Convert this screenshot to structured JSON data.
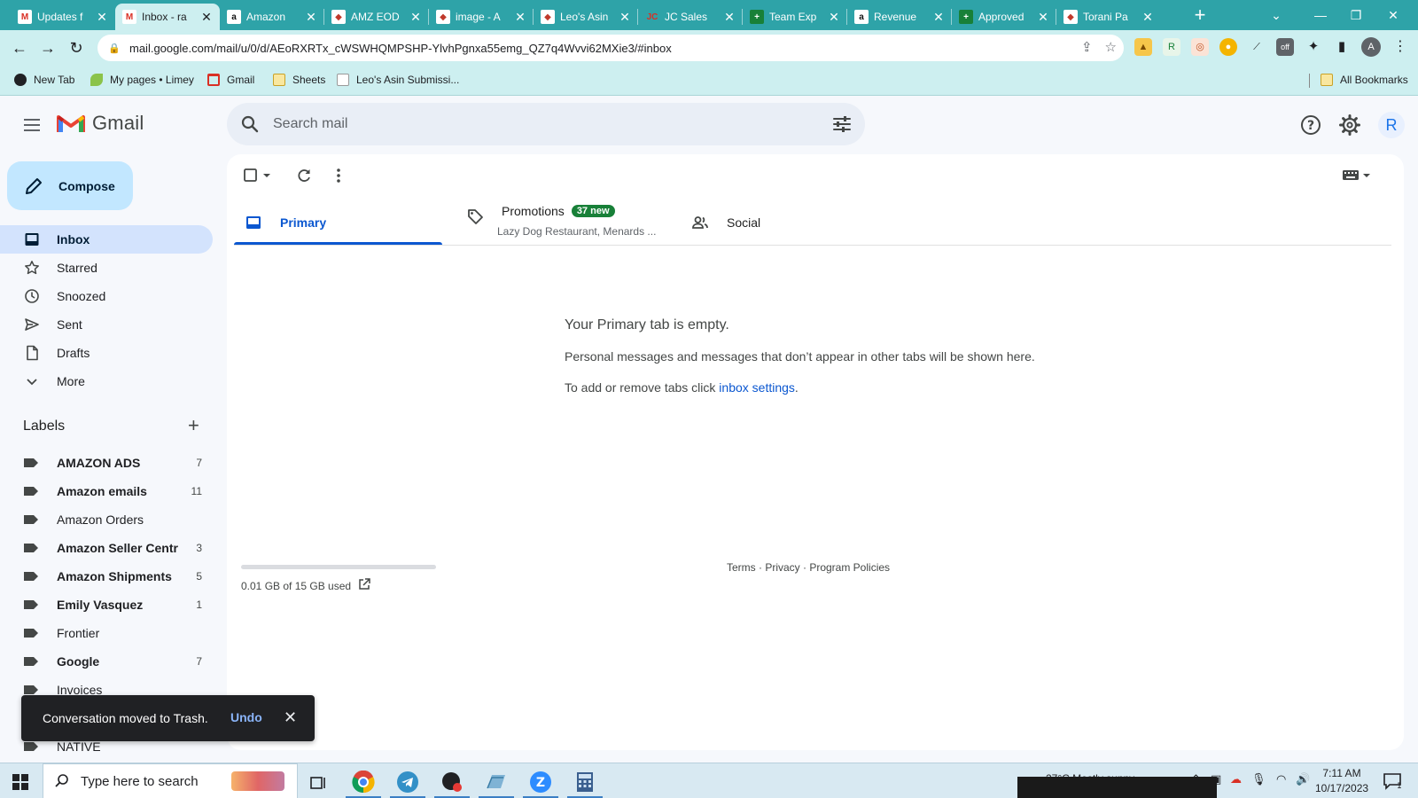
{
  "browser": {
    "tabs": [
      {
        "title": "Updates f",
        "favicon": "gmail-icon"
      },
      {
        "title": "Inbox - ra",
        "favicon": "gmail-icon",
        "active": true
      },
      {
        "title": "Amazon",
        "favicon": "amazon-icon"
      },
      {
        "title": "AMZ EOD",
        "favicon": "app-icon"
      },
      {
        "title": "image - A",
        "favicon": "app-icon"
      },
      {
        "title": "Leo's Asin",
        "favicon": "app-icon"
      },
      {
        "title": "JC Sales",
        "favicon": "jc-icon"
      },
      {
        "title": "Team Exp",
        "favicon": "sheets-icon"
      },
      {
        "title": "Revenue",
        "favicon": "amazon-icon"
      },
      {
        "title": "Approved",
        "favicon": "sheets-icon"
      },
      {
        "title": "Torani Pa",
        "favicon": "app-icon"
      }
    ],
    "url": "mail.google.com/mail/u/0/d/AEoRXRTx_cWSWHQMPSHP-YlvhPgnxa55emg_QZ7q4Wvvi62MXie3/#inbox",
    "profile_initial": "A",
    "bookmarks": [
      "New Tab",
      "My pages • Limey",
      "Gmail",
      "Sheets",
      "Leo's Asin Submissi..."
    ],
    "all_bookmarks": "All Bookmarks"
  },
  "gmail": {
    "logo_text": "Gmail",
    "search_placeholder": "Search mail",
    "avatar_initial": "R",
    "compose_label": "Compose",
    "nav": [
      {
        "label": "Inbox",
        "icon": "inbox-icon",
        "active": true
      },
      {
        "label": "Starred",
        "icon": "star-icon"
      },
      {
        "label": "Snoozed",
        "icon": "clock-icon"
      },
      {
        "label": "Sent",
        "icon": "send-icon"
      },
      {
        "label": "Drafts",
        "icon": "draft-icon"
      },
      {
        "label": "More",
        "icon": "chevron-down-icon"
      }
    ],
    "labels_heading": "Labels",
    "labels": [
      {
        "name": "AMAZON ADS",
        "count": "7",
        "bold": true
      },
      {
        "name": "Amazon emails",
        "count": "11",
        "bold": true
      },
      {
        "name": "Amazon Orders",
        "count": "",
        "bold": false
      },
      {
        "name": "Amazon Seller Centr",
        "count": "3",
        "bold": true
      },
      {
        "name": "Amazon Shipments",
        "count": "5",
        "bold": true
      },
      {
        "name": "Emily Vasquez",
        "count": "1",
        "bold": true
      },
      {
        "name": "Frontier",
        "count": "",
        "bold": false
      },
      {
        "name": "Google",
        "count": "7",
        "bold": true
      },
      {
        "name": "Invoices",
        "count": "",
        "bold": false
      },
      {
        "name": "",
        "count": "",
        "bold": false
      },
      {
        "name": "NATIVE",
        "count": "",
        "bold": false
      }
    ],
    "tabs": {
      "primary": "Primary",
      "promotions": "Promotions",
      "promotions_badge": "37 new",
      "promotions_snippet": "Lazy Dog Restaurant, Menards ...",
      "social": "Social"
    },
    "empty": {
      "title": "Your Primary tab is empty.",
      "line1": "Personal messages and messages that don’t appear in other tabs will be shown here.",
      "line2_prefix": "To add or remove tabs click ",
      "line2_link": "inbox settings",
      "line2_suffix": "."
    },
    "storage": {
      "text": "0.01 GB of 15 GB used",
      "used_fraction": 0.0007
    },
    "footer": "Terms · Privacy · Program Policies",
    "toast": {
      "message": "Conversation moved to Trash.",
      "action": "Undo"
    }
  },
  "taskbar": {
    "search_placeholder": "Type here to search",
    "weather": "27°C  Mostly sunny",
    "time": "7:11 AM",
    "date": "10/17/2023",
    "notification_count": "1"
  }
}
